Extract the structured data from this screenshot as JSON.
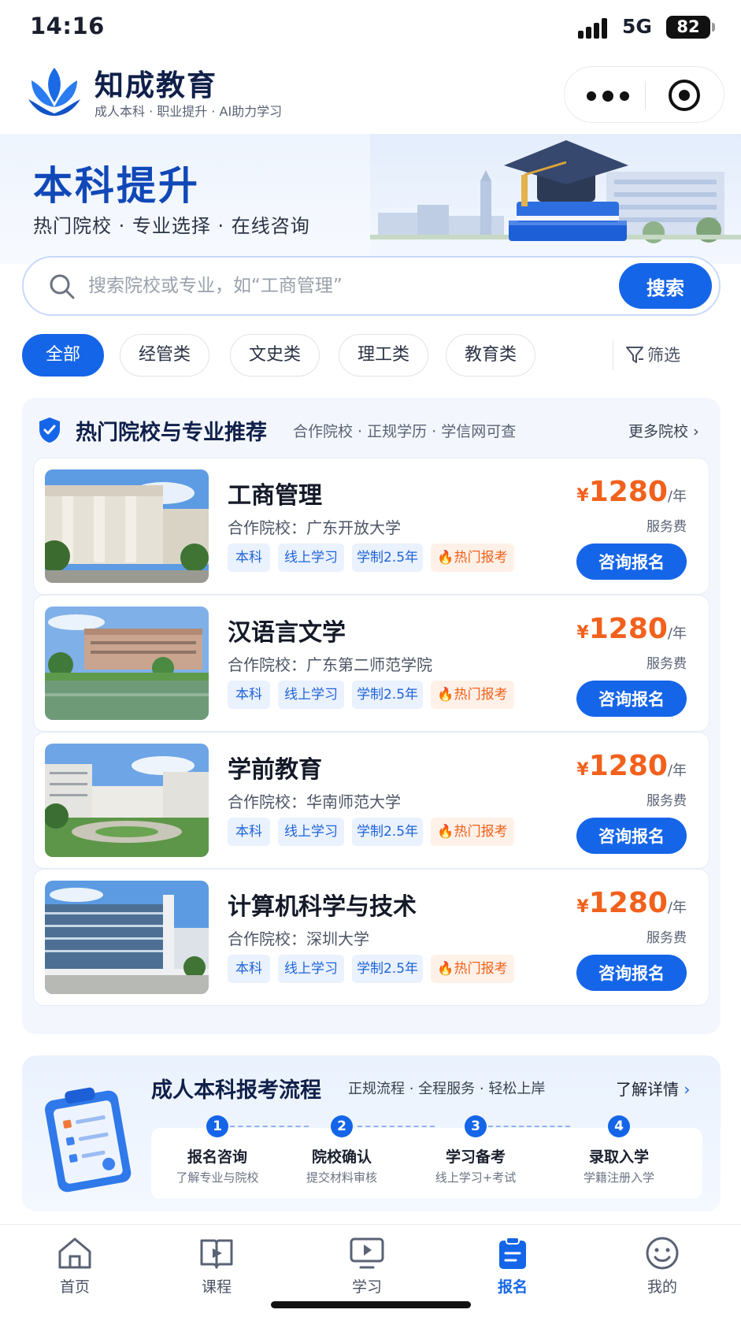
{
  "status_bar": {
    "time": "14:16",
    "network": "5G",
    "battery": "82"
  },
  "header": {
    "title": "知成教育",
    "subtitle": "成人本科 · 职业提升 · AI助力学习"
  },
  "banner": {
    "title": "本科提升",
    "subtitle": "热门院校 · 专业选择 · 在线咨询"
  },
  "search": {
    "placeholder": "搜索院校或专业，如“工商管理”",
    "button_label": "搜索"
  },
  "categories": {
    "items": [
      "全部",
      "经管类",
      "文史类",
      "理工类",
      "教育类"
    ],
    "active": "全部",
    "filter_label": "筛选"
  },
  "recommend": {
    "title": "热门院校与专业推荐",
    "subtitle": "合作院校 · 正规学历 · 学信网可查",
    "more_label": "更多院校",
    "courses": [
      {
        "name": "工商管理",
        "school": "合作院校：广东开放大学",
        "tags": [
          "本科",
          "线上学习",
          "学制2.5年",
          "热门报考"
        ],
        "currency": "¥",
        "price": "1280",
        "unit": "/年",
        "fee_label": "服务费",
        "button": "咨询报名"
      },
      {
        "name": "汉语言文学",
        "school": "合作院校：广东第二师范学院",
        "tags": [
          "本科",
          "线上学习",
          "学制2.5年",
          "热门报考"
        ],
        "currency": "¥",
        "price": "1280",
        "unit": "/年",
        "fee_label": "服务费",
        "button": "咨询报名"
      },
      {
        "name": "学前教育",
        "school": "合作院校：华南师范大学",
        "tags": [
          "本科",
          "线上学习",
          "学制2.5年",
          "热门报考"
        ],
        "currency": "¥",
        "price": "1280",
        "unit": "/年",
        "fee_label": "服务费",
        "button": "咨询报名"
      },
      {
        "name": "计算机科学与技术",
        "school": "合作院校：深圳大学",
        "tags": [
          "本科",
          "线上学习",
          "学制2.5年",
          "热门报考"
        ],
        "currency": "¥",
        "price": "1280",
        "unit": "/年",
        "fee_label": "服务费",
        "button": "咨询报名"
      }
    ]
  },
  "process": {
    "title": "成人本科报考流程",
    "subtitle": "正规流程 · 全程服务 · 轻松上岸",
    "more_label": "了解详情",
    "steps": [
      {
        "num": "1",
        "name": "报名咨询",
        "desc": "了解专业与院校"
      },
      {
        "num": "2",
        "name": "院校确认",
        "desc": "提交材料审核"
      },
      {
        "num": "3",
        "name": "学习备考",
        "desc": "线上学习+考试"
      },
      {
        "num": "4",
        "name": "录取入学",
        "desc": "学籍注册入学"
      }
    ]
  },
  "tabbar": {
    "items": [
      {
        "label": "首页",
        "icon": "home-icon"
      },
      {
        "label": "课程",
        "icon": "book-play-icon"
      },
      {
        "label": "学习",
        "icon": "screen-play-icon"
      },
      {
        "label": "报名",
        "icon": "clipboard-icon"
      },
      {
        "label": "我的",
        "icon": "smile-icon"
      }
    ],
    "active": "报名"
  },
  "colors": {
    "primary": "#1565e8",
    "price": "#f2611c",
    "title": "#10204a"
  }
}
